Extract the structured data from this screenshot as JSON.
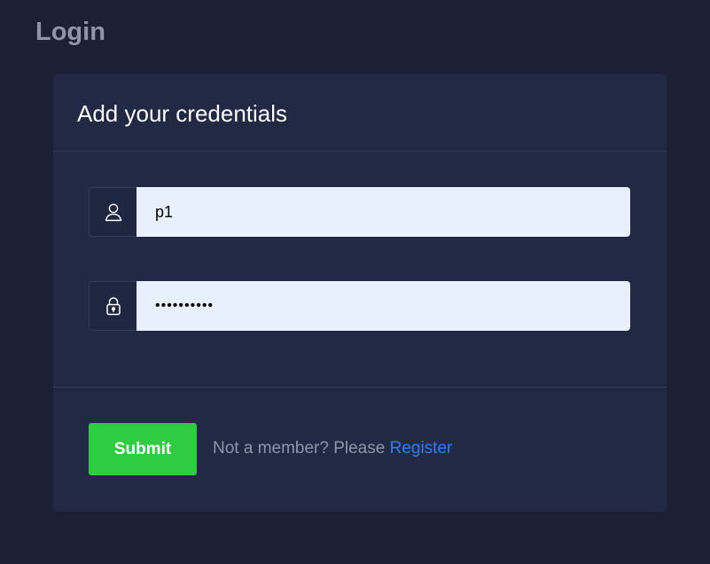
{
  "page": {
    "title": "Login"
  },
  "card": {
    "title": "Add your credentials"
  },
  "form": {
    "username": {
      "value": "p1",
      "icon": "user-icon"
    },
    "password": {
      "value": "••••••••••",
      "icon": "lock-icon"
    },
    "submit_label": "Submit",
    "register_prompt": "Not a member? Please",
    "register_link_label": "Register"
  },
  "colors": {
    "background": "#1c2035",
    "card": "#212944",
    "submit": "#2ecc40",
    "link": "#2e7cf6",
    "input_fill": "#e8f0fe"
  }
}
